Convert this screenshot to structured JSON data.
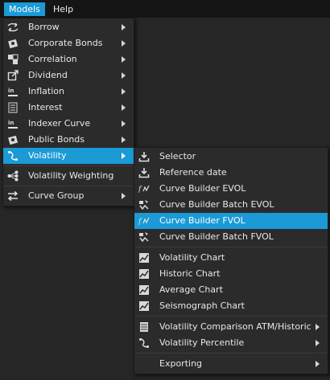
{
  "menubar": {
    "models": "Models",
    "help": "Help"
  },
  "models_menu": [
    {
      "label": "Borrow",
      "icon": "borrow-icon",
      "submenu": true
    },
    {
      "label": "Corporate Bonds",
      "icon": "corporate-bonds-icon",
      "submenu": true
    },
    {
      "label": "Correlation",
      "icon": "correlation-icon",
      "submenu": true
    },
    {
      "label": "Dividend",
      "icon": "dividend-icon",
      "submenu": true
    },
    {
      "label": "Inflation",
      "icon": "inflation-icon",
      "submenu": true
    },
    {
      "label": "Interest",
      "icon": "interest-icon",
      "submenu": true
    },
    {
      "label": "Indexer Curve",
      "icon": "indexer-curve-icon",
      "submenu": true
    },
    {
      "label": "Public Bonds",
      "icon": "public-bonds-icon",
      "submenu": true
    },
    {
      "label": "Volatility",
      "icon": "volatility-icon",
      "submenu": true,
      "highlighted": true
    },
    {
      "label": "Volatility Weighting",
      "icon": "volatility-weighting-icon",
      "submenu": false
    },
    {
      "label": "Curve Group",
      "icon": "curve-group-icon",
      "submenu": true
    }
  ],
  "volatility_menu": [
    {
      "label": "Selector",
      "icon": "download-icon",
      "submenu": false
    },
    {
      "label": "Reference date",
      "icon": "download-icon",
      "submenu": false
    },
    {
      "label": "Curve Builder EVOL",
      "icon": "curve-builder-icon",
      "submenu": false
    },
    {
      "label": "Curve Builder Batch EVOL",
      "icon": "batch-icon",
      "submenu": false
    },
    {
      "label": "Curve Builder FVOL",
      "icon": "curve-builder-icon",
      "submenu": false,
      "highlighted": true
    },
    {
      "label": "Curve Builder Batch FVOL",
      "icon": "batch-icon",
      "submenu": false
    },
    {
      "label": "Volatility Chart",
      "icon": "chart-icon",
      "submenu": false
    },
    {
      "label": "Historic Chart",
      "icon": "chart-icon",
      "submenu": false
    },
    {
      "label": "Average Chart",
      "icon": "chart-icon",
      "submenu": false
    },
    {
      "label": "Seismograph Chart",
      "icon": "chart-icon",
      "submenu": false
    },
    {
      "label": "Volatility Comparison ATM/Historic",
      "icon": "table-icon",
      "submenu": true
    },
    {
      "label": "Volatility Percentile",
      "icon": "percentile-icon",
      "submenu": true
    },
    {
      "label": "Exporting",
      "icon": "",
      "submenu": true
    }
  ],
  "colors": {
    "accent": "#1b9ad6",
    "menu_bg": "#2b2b2b",
    "bar_bg": "#151515"
  }
}
